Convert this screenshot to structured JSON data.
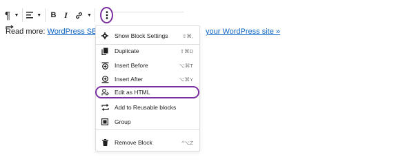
{
  "toolbar": {
    "paragraph_icon": "paragraph-icon",
    "align_icon": "align-left-icon",
    "bold_label": "B",
    "italic_label": "I",
    "link_icon": "link-icon",
    "more_icon": "more-vertical-icon"
  },
  "content": {
    "prefix": "Read more: ",
    "link_start": "WordPress SEO: the",
    "link_end": "your WordPress site »"
  },
  "menu": {
    "items": [
      {
        "label": "Show Block Settings",
        "shortcut": "⇧⌘,",
        "icon": "gear-icon"
      },
      {
        "label": "Duplicate",
        "shortcut": "⇧⌘D",
        "icon": "duplicate-icon"
      },
      {
        "label": "Insert Before",
        "shortcut": "⌥⌘T",
        "icon": "insert-before-icon"
      },
      {
        "label": "Insert After",
        "shortcut": "⌥⌘Y",
        "icon": "insert-after-icon"
      },
      {
        "label": "Edit as HTML",
        "shortcut": "",
        "icon": "html-icon"
      },
      {
        "label": "Add to Reusable blocks",
        "shortcut": "",
        "icon": "reusable-icon"
      },
      {
        "label": "Group",
        "shortcut": "",
        "icon": "group-icon"
      },
      {
        "label": "Remove Block",
        "shortcut": "^⌥Z",
        "icon": "trash-icon"
      }
    ]
  },
  "colors": {
    "highlight": "#7c2fa0",
    "link": "#0a62c4"
  }
}
